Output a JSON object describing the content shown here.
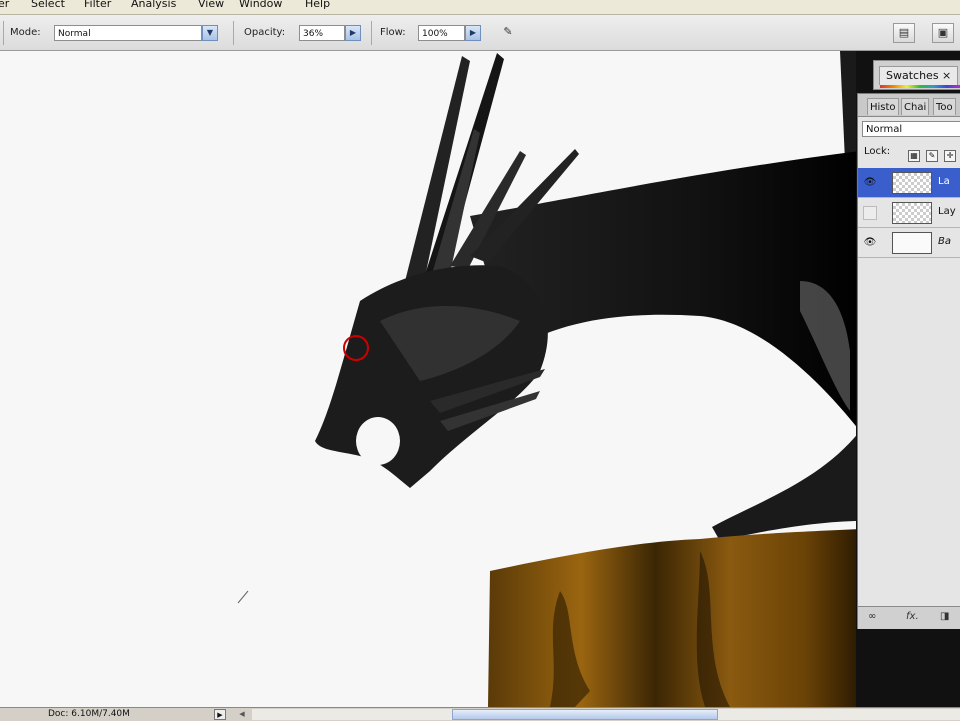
{
  "menu": [
    "er",
    "Select",
    "Filter",
    "Analysis",
    "View",
    "Window",
    "Help"
  ],
  "options": {
    "mode_label": "Mode:",
    "mode_value": "Normal",
    "opacity_label": "Opacity:",
    "opacity_value": "36%",
    "flow_label": "Flow:",
    "flow_value": "100%"
  },
  "swatches_tab": "Swatches ×",
  "layers_panel": {
    "tabs": [
      "Histo",
      "Chai",
      "Too"
    ],
    "blend_mode": "Normal",
    "lock_label": "Lock:",
    "layers": [
      {
        "name": "La",
        "visible": true,
        "selected": true
      },
      {
        "name": "Lay",
        "visible": false,
        "selected": false
      },
      {
        "name": "Ba",
        "visible": true,
        "selected": false
      }
    ],
    "footer": [
      "∞",
      "fx."
    ]
  },
  "status": {
    "doc": "Doc: 6.10M/7.40M",
    "arrow": "▶",
    "arrow2": "◀"
  },
  "colors": {
    "selection_blue": "#3a5fcd",
    "brush_cursor": "#cc0000",
    "wood_brown": "#8a5a10"
  }
}
